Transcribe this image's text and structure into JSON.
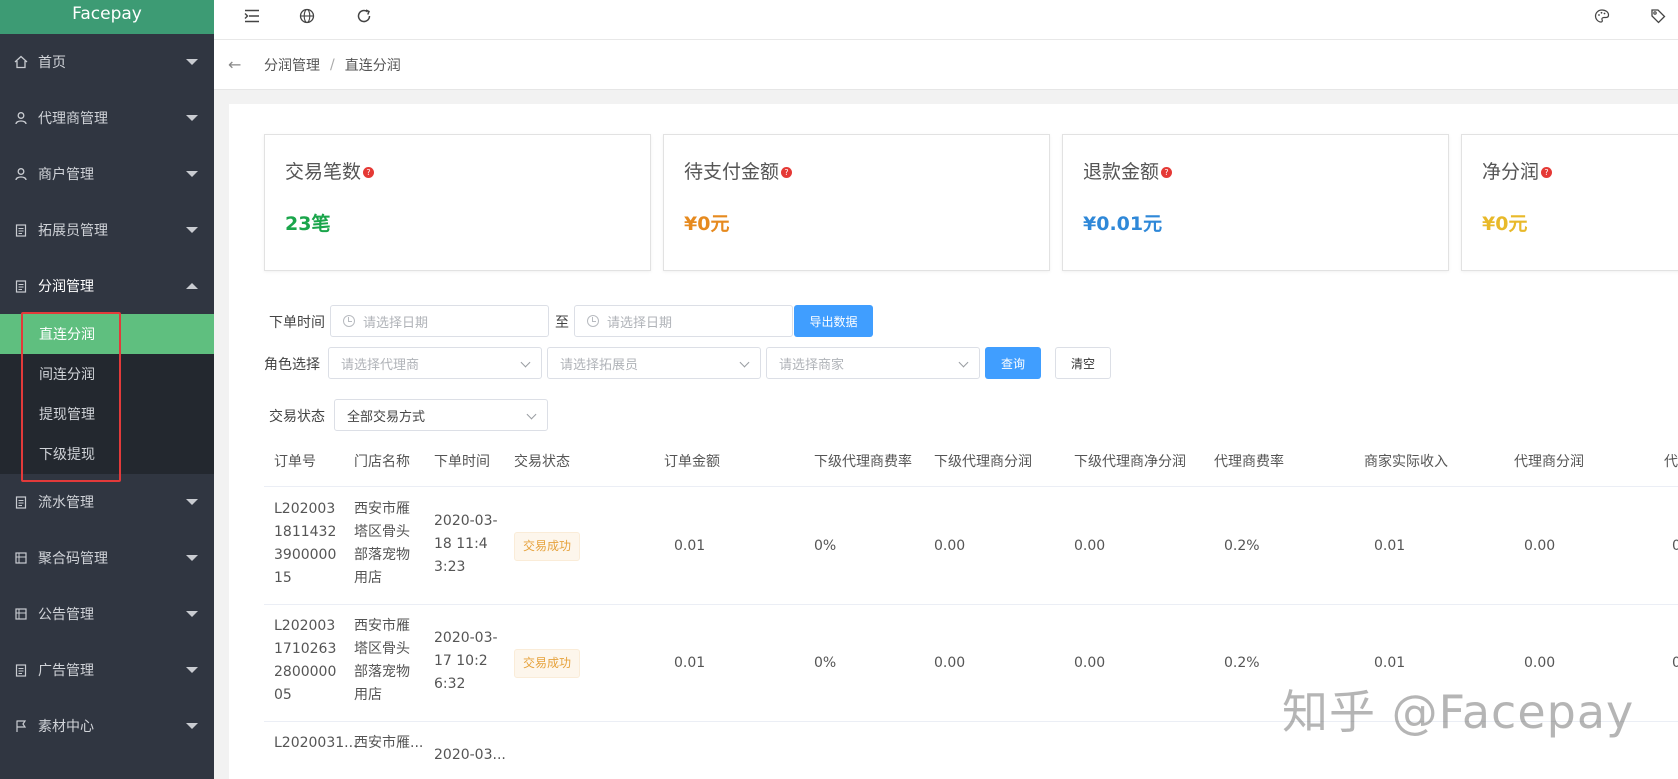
{
  "app": {
    "title": "Facepay"
  },
  "sidebar": {
    "items": [
      {
        "label": "首页",
        "icon": "home-icon"
      },
      {
        "label": "代理商管理",
        "icon": "user-icon"
      },
      {
        "label": "商户管理",
        "icon": "user-icon"
      },
      {
        "label": "拓展员管理",
        "icon": "clipboard-icon"
      },
      {
        "label": "分润管理",
        "icon": "clipboard-icon",
        "expanded": true
      },
      {
        "label": "流水管理",
        "icon": "clipboard-icon"
      },
      {
        "label": "聚合码管理",
        "icon": "grid-icon"
      },
      {
        "label": "公告管理",
        "icon": "grid-icon"
      },
      {
        "label": "广告管理",
        "icon": "clipboard-icon"
      },
      {
        "label": "素材中心",
        "icon": "flag-icon"
      }
    ],
    "sub_items": [
      {
        "label": "直连分润",
        "active": true
      },
      {
        "label": "间连分润"
      },
      {
        "label": "提现管理"
      },
      {
        "label": "下级提现"
      }
    ]
  },
  "breadcrumb": {
    "parent": "分润管理",
    "sep": "/",
    "current": "直连分润"
  },
  "stats": [
    {
      "title": "交易笔数",
      "value": "23笔",
      "color": "#1aa54b"
    },
    {
      "title": "待支付金额",
      "value": "¥0元",
      "color": "#e68a1f"
    },
    {
      "title": "退款金额",
      "value": "¥0.01元",
      "color": "#2f88d8"
    },
    {
      "title": "净分润",
      "value": "¥0元",
      "color": "#e8b92a"
    }
  ],
  "filters": {
    "order_time_label": "下单时间",
    "date_start_placeholder": "请选择日期",
    "to_label": "至",
    "date_end_placeholder": "请选择日期",
    "export_button": "导出数据",
    "role_label": "角色选择",
    "agent_placeholder": "请选择代理商",
    "promoter_placeholder": "请选择拓展员",
    "merchant_placeholder": "请选择商家",
    "search_button": "查询",
    "clear_button": "清空",
    "status_label": "交易状态",
    "status_value": "全部交易方式"
  },
  "table": {
    "headers": [
      "订单号",
      "门店名称",
      "下单时间",
      "交易状态",
      "订单金额",
      "下级代理商费率",
      "下级代理商分润",
      "下级代理商净分润",
      "代理商费率",
      "商家实际收入",
      "代理商分润",
      "代"
    ],
    "rows": [
      {
        "order_no": "L2020031811432390000015",
        "store": "西安市雁塔区骨头部落宠物用店",
        "time": "2020-03-18 11:43:23",
        "status": "交易成功",
        "amount": "0.01",
        "sub_rate": "0%",
        "sub_profit": "0.00",
        "sub_net": "0.00",
        "agent_rate": "0.2%",
        "merchant_income": "0.01",
        "agent_profit": "0.00",
        "extra": "0"
      },
      {
        "order_no": "L2020031710263280000005",
        "store": "西安市雁塔区骨头部落宠物用店",
        "time": "2020-03-17 10:26:32",
        "status": "交易成功",
        "amount": "0.01",
        "sub_rate": "0%",
        "sub_profit": "0.00",
        "sub_net": "0.00",
        "agent_rate": "0.2%",
        "merchant_income": "0.01",
        "agent_profit": "0.00",
        "extra": "0"
      },
      {
        "order_no": "L2020031...",
        "store": "西安市雁...",
        "time": "2020-03...",
        "status": "",
        "amount": "",
        "sub_rate": "",
        "sub_profit": "",
        "sub_net": "",
        "agent_rate": "",
        "merchant_income": "",
        "agent_profit": "",
        "extra": ""
      }
    ]
  },
  "watermark": "知乎 @Facepay"
}
